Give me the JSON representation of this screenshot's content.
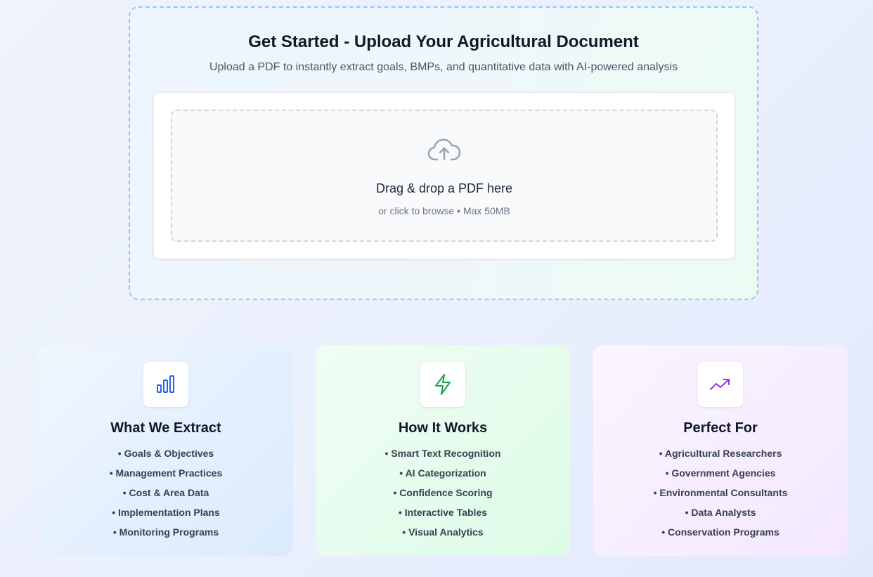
{
  "upload": {
    "title": "Get Started - Upload Your Agricultural Document",
    "subtitle": "Upload a PDF to instantly extract goals, BMPs, and quantitative data with AI-powered analysis",
    "dropzone_icon": "cloud-upload-icon",
    "drop_text": "Drag & drop a PDF here",
    "browse_text": "or click to browse • Max 50MB"
  },
  "cards": [
    {
      "icon": "bar-chart-icon",
      "icon_color": "#2563eb",
      "title": "What We Extract",
      "items": [
        "• Goals & Objectives",
        "• Management Practices",
        "• Cost & Area Data",
        "• Implementation Plans",
        "• Monitoring Programs"
      ]
    },
    {
      "icon": "lightning-bolt-icon",
      "icon_color": "#16a34a",
      "title": "How It Works",
      "items": [
        "• Smart Text Recognition",
        "• AI Categorization",
        "• Confidence Scoring",
        "• Interactive Tables",
        "• Visual Analytics"
      ]
    },
    {
      "icon": "trending-up-icon",
      "icon_color": "#9333ea",
      "title": "Perfect For",
      "items": [
        "• Agricultural Researchers",
        "• Government Agencies",
        "• Environmental Consultants",
        "• Data Analysts",
        "• Conservation Programs"
      ]
    }
  ]
}
